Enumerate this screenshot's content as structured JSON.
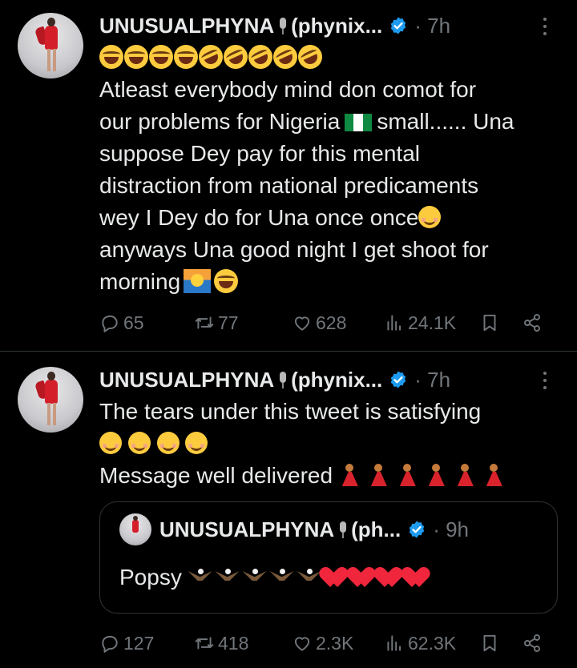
{
  "tweets": [
    {
      "author": "UNUSUALPHYNA",
      "handle": "(phynix...",
      "time": "· 7h",
      "lines": [
        "Atleast everybody mind don comot for",
        "our problems for Nigeria",
        "small...... Una",
        "suppose Dey pay for this mental",
        "distraction from national predicaments",
        "wey I Dey do for Una once once",
        "anyways Una good night I get shoot for",
        "morning"
      ],
      "stats": {
        "replies": "65",
        "retweets": "77",
        "likes": "628",
        "views": "24.1K"
      }
    },
    {
      "author": "UNUSUALPHYNA",
      "handle": "(phynix...",
      "time": "· 7h",
      "lines": [
        "The tears under this tweet is satisfying",
        "Message well delivered"
      ],
      "quote": {
        "author": "UNUSUALPHYNA",
        "handle": "(ph...",
        "time": "· 9h",
        "text": "Popsy"
      },
      "stats": {
        "replies": "127",
        "retweets": "418",
        "likes": "2.3K",
        "views": "62.3K"
      }
    }
  ],
  "icons": [
    "more-icon",
    "verified-icon",
    "reply-icon",
    "retweet-icon",
    "like-icon",
    "views-icon",
    "bookmark-icon",
    "share-icon"
  ],
  "colors": {
    "background": "#000000",
    "text": "#e7e9ea",
    "muted": "#71767b",
    "verified": "#1d9bf0",
    "divider": "#2f3336"
  }
}
